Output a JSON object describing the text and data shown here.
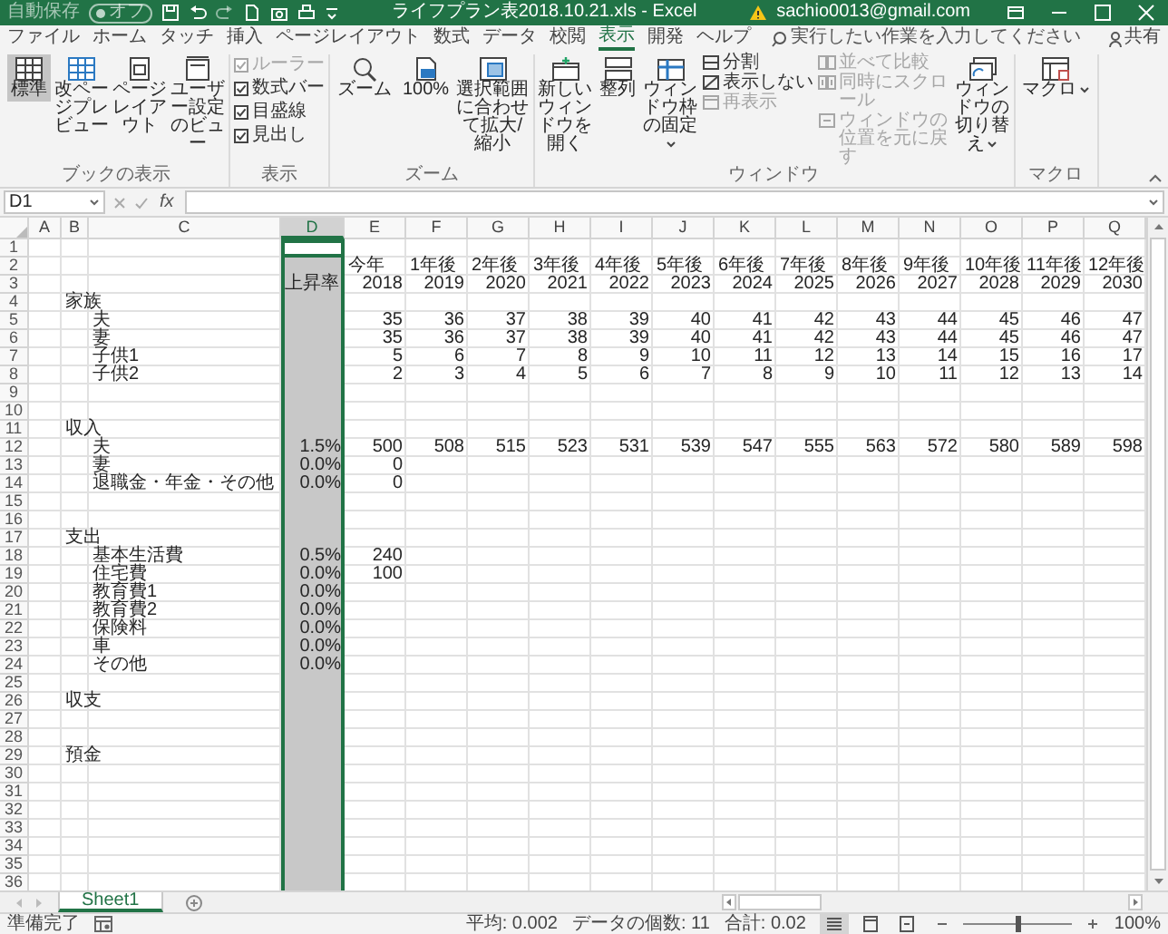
{
  "title_bar": {
    "autosave_label": "自動保存",
    "autosave_state": "オフ",
    "title": "ライフプラン表2018.10.21.xls - Excel",
    "account": "sachio0013@gmail.com"
  },
  "ribbon_tabs": [
    {
      "label": "ファイル",
      "selected": false
    },
    {
      "label": "ホーム",
      "selected": false
    },
    {
      "label": "タッチ",
      "selected": false
    },
    {
      "label": "挿入",
      "selected": false
    },
    {
      "label": "ページレイアウト",
      "selected": false
    },
    {
      "label": "数式",
      "selected": false
    },
    {
      "label": "データ",
      "selected": false
    },
    {
      "label": "校閲",
      "selected": false
    },
    {
      "label": "表示",
      "selected": true
    },
    {
      "label": "開発",
      "selected": false
    },
    {
      "label": "ヘルプ",
      "selected": false
    }
  ],
  "tell_me": {
    "placeholder": "実行したい作業を入力してください"
  },
  "share": "共有",
  "ribbon_groups": [
    {
      "label": "ブックの表示",
      "items": [
        {
          "kind": "large",
          "label": "標準",
          "selected": true,
          "dropdown": false
        },
        {
          "kind": "large",
          "label": "改ページプレビュー",
          "selected": false,
          "dropdown": false
        },
        {
          "kind": "large",
          "label": "ページレイアウト",
          "selected": false,
          "dropdown": false
        },
        {
          "kind": "large",
          "label": "ユーザー設定のビュー",
          "selected": false,
          "dropdown": false
        }
      ]
    },
    {
      "label": "表示",
      "items": [
        {
          "kind": "stack",
          "items": [
            {
              "kind": "check",
              "label": "ルーラー",
              "checked": true,
              "disabled": true
            },
            {
              "kind": "check",
              "label": "数式バー",
              "checked": true,
              "disabled": false
            },
            {
              "kind": "check",
              "label": "目盛線",
              "checked": true,
              "disabled": false
            },
            {
              "kind": "check",
              "label": "見出し",
              "checked": true,
              "disabled": false
            }
          ]
        }
      ]
    },
    {
      "label": "ズーム",
      "items": [
        {
          "kind": "large",
          "label": "ズーム",
          "selected": false,
          "dropdown": false
        },
        {
          "kind": "large",
          "label": "100%",
          "selected": false,
          "dropdown": false
        },
        {
          "kind": "large",
          "label": "選択範囲に合わせて拡大/縮小",
          "selected": false,
          "dropdown": false
        }
      ]
    },
    {
      "label": "ウィンドウ",
      "items": [
        {
          "kind": "large",
          "label": "新しいウィンドウを開く",
          "selected": false,
          "dropdown": false
        },
        {
          "kind": "large",
          "label": "整列",
          "selected": false,
          "dropdown": false
        },
        {
          "kind": "large",
          "label": "ウィンドウ枠の固定",
          "selected": false,
          "dropdown": true
        },
        {
          "kind": "stack",
          "items": [
            {
              "kind": "small",
              "label": "分割",
              "disabled": false
            },
            {
              "kind": "small",
              "label": "表示しない",
              "disabled": false
            },
            {
              "kind": "small",
              "label": "再表示",
              "disabled": true
            }
          ]
        },
        {
          "kind": "stack",
          "items": [
            {
              "kind": "small",
              "label": "並べて比較",
              "disabled": true
            },
            {
              "kind": "small",
              "label": "同時にスクロール",
              "disabled": true
            },
            {
              "kind": "small",
              "label": "ウィンドウの位置を元に戻す",
              "disabled": true
            }
          ]
        },
        {
          "kind": "large",
          "label": "ウィンドウの切り替え",
          "selected": false,
          "dropdown": true
        }
      ]
    },
    {
      "label": "マクロ",
      "items": [
        {
          "kind": "large",
          "label": "マクロ",
          "selected": false,
          "dropdown": true
        }
      ]
    }
  ],
  "formula_bar": {
    "name_box": "D1",
    "function_label": "fx"
  },
  "sheet": {
    "columns": [
      {
        "label": "A",
        "selected": false
      },
      {
        "label": "B",
        "selected": false
      },
      {
        "label": "C",
        "selected": false
      },
      {
        "label": "D",
        "selected": true
      },
      {
        "label": "E",
        "selected": false
      },
      {
        "label": "F",
        "selected": false
      },
      {
        "label": "G",
        "selected": false
      },
      {
        "label": "H",
        "selected": false
      },
      {
        "label": "I",
        "selected": false
      },
      {
        "label": "J",
        "selected": false
      },
      {
        "label": "K",
        "selected": false
      },
      {
        "label": "L",
        "selected": false
      },
      {
        "label": "M",
        "selected": false
      },
      {
        "label": "N",
        "selected": false
      },
      {
        "label": "O",
        "selected": false
      },
      {
        "label": "P",
        "selected": false
      },
      {
        "label": "Q",
        "selected": false
      }
    ],
    "rows": [
      {
        "number": "1"
      },
      {
        "number": "2",
        "e": "今年",
        "f": "1年後",
        "g": "2年後",
        "h": "3年後",
        "i": "4年後",
        "j": "5年後",
        "k": "6年後",
        "l": "7年後",
        "m": "8年後",
        "n": "9年後",
        "o": "10年後",
        "p": "11年後",
        "q": "12年後"
      },
      {
        "number": "3",
        "d": "上昇率",
        "e": "2018",
        "f": "2019",
        "g": "2020",
        "h": "2021",
        "i": "2022",
        "j": "2023",
        "k": "2024",
        "l": "2025",
        "m": "2026",
        "n": "2027",
        "o": "2028",
        "p": "2029",
        "q": "2030"
      },
      {
        "number": "4",
        "b": "家族"
      },
      {
        "number": "5",
        "c": "夫",
        "e": "35",
        "f": "36",
        "g": "37",
        "h": "38",
        "i": "39",
        "j": "40",
        "k": "41",
        "l": "42",
        "m": "43",
        "n": "44",
        "o": "45",
        "p": "46",
        "q": "47"
      },
      {
        "number": "6",
        "c": "妻",
        "e": "35",
        "f": "36",
        "g": "37",
        "h": "38",
        "i": "39",
        "j": "40",
        "k": "41",
        "l": "42",
        "m": "43",
        "n": "44",
        "o": "45",
        "p": "46",
        "q": "47"
      },
      {
        "number": "7",
        "c": "子供1",
        "e": "5",
        "f": "6",
        "g": "7",
        "h": "8",
        "i": "9",
        "j": "10",
        "k": "11",
        "l": "12",
        "m": "13",
        "n": "14",
        "o": "15",
        "p": "16",
        "q": "17"
      },
      {
        "number": "8",
        "c": "子供2",
        "e": "2",
        "f": "3",
        "g": "4",
        "h": "5",
        "i": "6",
        "j": "7",
        "k": "8",
        "l": "9",
        "m": "10",
        "n": "11",
        "o": "12",
        "p": "13",
        "q": "14"
      },
      {
        "number": "9"
      },
      {
        "number": "10"
      },
      {
        "number": "11",
        "b": "収入"
      },
      {
        "number": "12",
        "c": "夫",
        "d": "1.5%",
        "e": "500",
        "f": "508",
        "g": "515",
        "h": "523",
        "i": "531",
        "j": "539",
        "k": "547",
        "l": "555",
        "m": "563",
        "n": "572",
        "o": "580",
        "p": "589",
        "q": "598"
      },
      {
        "number": "13",
        "c": "妻",
        "d": "0.0%",
        "e": "0"
      },
      {
        "number": "14",
        "c": "退職金・年金・その他",
        "d": "0.0%",
        "e": "0"
      },
      {
        "number": "15"
      },
      {
        "number": "16"
      },
      {
        "number": "17",
        "b": "支出"
      },
      {
        "number": "18",
        "c": "基本生活費",
        "d": "0.5%",
        "e": "240"
      },
      {
        "number": "19",
        "c": "住宅費",
        "d": "0.0%",
        "e": "100"
      },
      {
        "number": "20",
        "c": "教育費1",
        "d": "0.0%"
      },
      {
        "number": "21",
        "c": "教育費2",
        "d": "0.0%"
      },
      {
        "number": "22",
        "c": "保険料",
        "d": "0.0%"
      },
      {
        "number": "23",
        "c": "車",
        "d": "0.0%"
      },
      {
        "number": "24",
        "c": "その他",
        "d": "0.0%"
      },
      {
        "number": "25"
      },
      {
        "number": "26",
        "b": "収支"
      },
      {
        "number": "27"
      },
      {
        "number": "28"
      },
      {
        "number": "29",
        "b": "預金"
      },
      {
        "number": "30"
      },
      {
        "number": "31"
      },
      {
        "number": "32"
      },
      {
        "number": "33"
      },
      {
        "number": "34"
      },
      {
        "number": "35"
      },
      {
        "number": "36"
      }
    ]
  },
  "sheet_tabs": [
    {
      "label": "Sheet1",
      "selected": true
    }
  ],
  "status_bar": {
    "ready": "準備完了",
    "average": "平均: 0.002",
    "count": "データの個数: 11",
    "sum": "合計: 0.02",
    "views": [
      {
        "selected": true
      },
      {
        "selected": false
      },
      {
        "selected": false
      }
    ],
    "zoom": {
      "level": 0.5,
      "label": "100%"
    }
  }
}
